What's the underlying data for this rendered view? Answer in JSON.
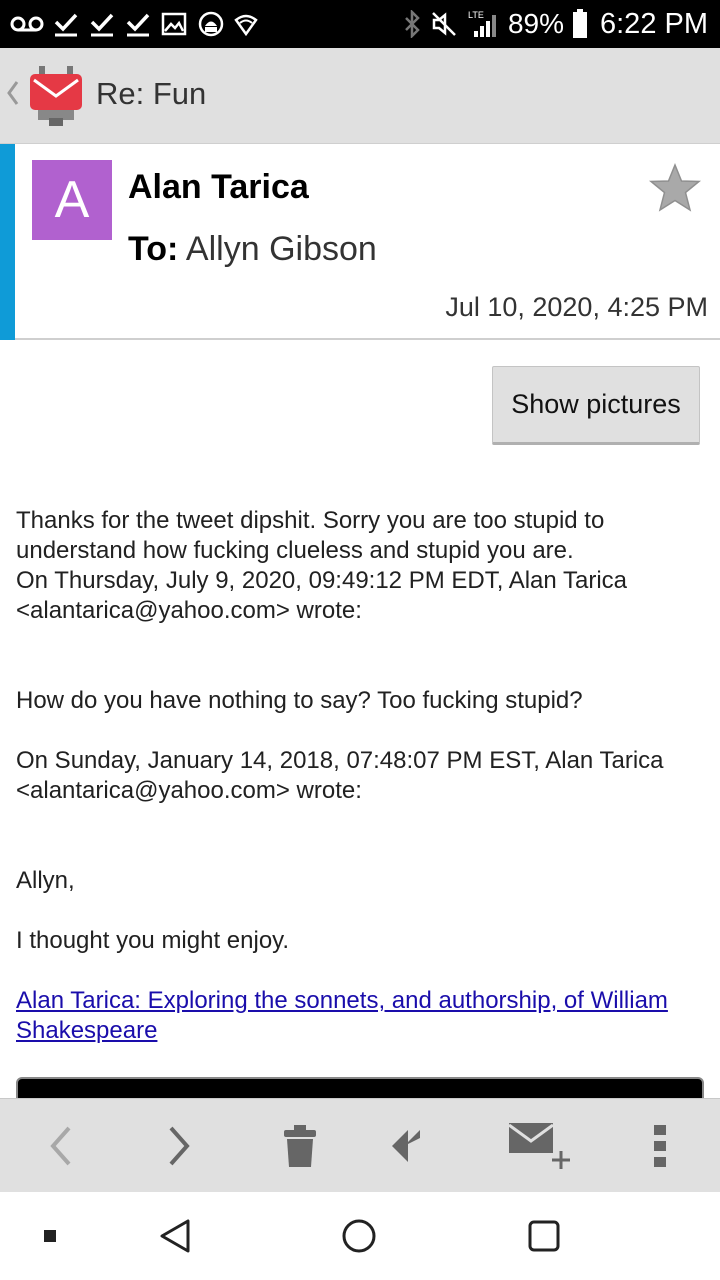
{
  "status_bar": {
    "left_icons": [
      "voicemail-icon",
      "check-icon",
      "check-icon",
      "check-icon",
      "image-icon",
      "android-debug-icon",
      "wifi-icon"
    ],
    "right_icons": [
      "bluetooth-icon",
      "mute-icon",
      "lte-signal-icon",
      "battery-icon"
    ],
    "network_label": "LTE",
    "battery_percent": "89%",
    "time": "6:22 PM"
  },
  "app_bar": {
    "title": "Re: Fun",
    "back_icon": "chevron-left-icon",
    "logo_icon": "k9-mail-logo-icon"
  },
  "message_header": {
    "avatar_letter": "A",
    "avatar_color": "#b161cf",
    "accent_color": "#0f9bd7",
    "sender": "Alan Tarica",
    "to_label": "To:",
    "recipient": "Allyn Gibson",
    "date": "Jul 10, 2020, 4:25 PM",
    "starred": false
  },
  "show_pictures_label": "Show pictures",
  "body": {
    "p1": "Thanks for the tweet dipshit.  Sorry you are too stupid to understand how fucking clueless and stupid you are.",
    "quote1": "On Thursday, July 9, 2020, 09:49:12 PM EDT, Alan Tarica <alantarica@yahoo.com> wrote:",
    "p2": "How do you have nothing to say?  Too fucking stupid?",
    "quote2": "On Sunday, January 14, 2018, 07:48:07 PM EST, Alan Tarica <alantarica@yahoo.com> wrote:",
    "greeting": "Allyn,",
    "p3": "I thought you might enjoy.",
    "link": "Alan Tarica: Exploring the sonnets, and authorship, of William Shakespeare"
  },
  "toolbar": {
    "items": [
      "previous-icon",
      "next-icon",
      "delete-icon",
      "reply-all-icon",
      "compose-icon",
      "overflow-menu-icon"
    ]
  },
  "nav_bar": {
    "items": [
      "recent-apps-icon",
      "back-icon",
      "home-icon",
      "overview-icon"
    ]
  }
}
